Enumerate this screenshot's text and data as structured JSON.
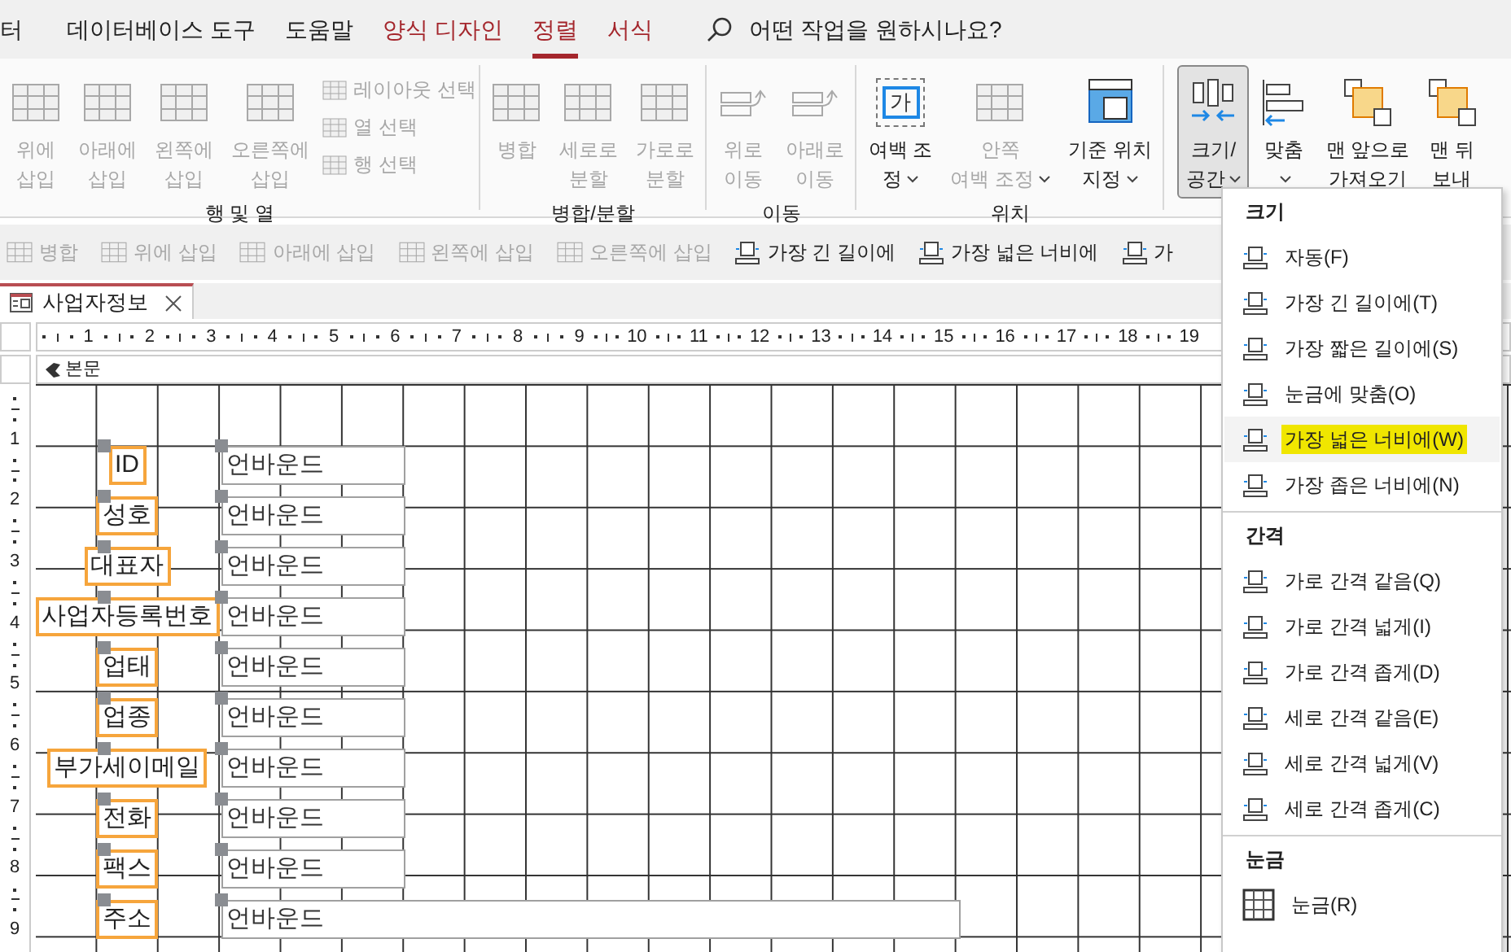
{
  "menu_tabs": [
    {
      "label": "터",
      "selected": false,
      "contextual": false
    },
    {
      "label": "데이터베이스 도구",
      "selected": false,
      "contextual": false
    },
    {
      "label": "도움말",
      "selected": false,
      "contextual": false
    },
    {
      "label": "양식 디자인",
      "selected": false,
      "contextual": true
    },
    {
      "label": "정렬",
      "selected": true,
      "contextual": true
    },
    {
      "label": "서식",
      "selected": false,
      "contextual": true
    }
  ],
  "search": {
    "placeholder": "어떤 작업을 원하시나요?"
  },
  "ribbon_groups": [
    {
      "label": "행 및 열",
      "buttons": [
        {
          "lines": [
            "위에",
            "삽입"
          ],
          "disabled": true,
          "dropdown": false,
          "pressed": false
        },
        {
          "lines": [
            "아래에",
            "삽입"
          ],
          "disabled": true,
          "dropdown": false,
          "pressed": false
        },
        {
          "lines": [
            "왼쪽에",
            "삽입"
          ],
          "disabled": true,
          "dropdown": false,
          "pressed": false
        },
        {
          "lines": [
            "오른쪽에",
            "삽입"
          ],
          "disabled": true,
          "dropdown": false,
          "pressed": false
        }
      ],
      "small_buttons": [
        {
          "label": "레이아웃 선택",
          "disabled": true
        },
        {
          "label": "열 선택",
          "disabled": true
        },
        {
          "label": "행 선택",
          "disabled": true
        }
      ]
    },
    {
      "label": "병합/분할",
      "buttons": [
        {
          "lines": [
            "병합"
          ],
          "disabled": true,
          "dropdown": false,
          "pressed": false
        },
        {
          "lines": [
            "세로로",
            "분할"
          ],
          "disabled": true,
          "dropdown": false,
          "pressed": false
        },
        {
          "lines": [
            "가로로",
            "분할"
          ],
          "disabled": true,
          "dropdown": false,
          "pressed": false
        }
      ]
    },
    {
      "label": "이동",
      "buttons": [
        {
          "lines": [
            "위로",
            "이동"
          ],
          "disabled": true,
          "dropdown": false,
          "pressed": false
        },
        {
          "lines": [
            "아래로",
            "이동"
          ],
          "disabled": true,
          "dropdown": false,
          "pressed": false
        }
      ]
    },
    {
      "label": "위치",
      "buttons": [
        {
          "lines": [
            "여백 조",
            "정"
          ],
          "disabled": false,
          "dropdown": true,
          "pressed": false,
          "icon_text": "가"
        },
        {
          "lines": [
            "안쪽",
            "여백 조정"
          ],
          "disabled": true,
          "dropdown": true,
          "pressed": false
        },
        {
          "lines": [
            "기준 위치",
            "지정"
          ],
          "disabled": false,
          "dropdown": true,
          "pressed": false
        }
      ]
    },
    {
      "buttons": [
        {
          "lines": [
            "크기/",
            "공간"
          ],
          "disabled": false,
          "dropdown": true,
          "pressed": true
        },
        {
          "lines": [
            "맞춤"
          ],
          "disabled": false,
          "dropdown": true,
          "pressed": false
        },
        {
          "lines": [
            "맨 앞으로",
            "가져오기"
          ],
          "disabled": false,
          "dropdown": false,
          "pressed": false
        },
        {
          "lines": [
            "맨 뒤",
            "보내"
          ],
          "disabled": false,
          "dropdown": false,
          "pressed": false
        }
      ]
    }
  ],
  "quick_toolbar": [
    {
      "label": "병합",
      "disabled": true
    },
    {
      "label": "위에 삽입",
      "disabled": true
    },
    {
      "label": "아래에 삽입",
      "disabled": true
    },
    {
      "label": "왼쪽에 삽입",
      "disabled": true
    },
    {
      "label": "오른쪽에 삽입",
      "disabled": true
    },
    {
      "label": "가장 긴 길이에",
      "disabled": false
    },
    {
      "label": "가장 넓은 너비에",
      "disabled": false
    },
    {
      "label": "가",
      "disabled": false
    }
  ],
  "document_tab": {
    "title": "사업자정보"
  },
  "ruler": [
    "1",
    "2",
    "3",
    "4",
    "5",
    "6",
    "7",
    "8",
    "9",
    "10",
    "11",
    "12",
    "13",
    "14",
    "15",
    "16",
    "17",
    "18",
    "19"
  ],
  "vertical_ruler": [
    "1",
    "2",
    "3",
    "4",
    "5",
    "6",
    "7",
    "8",
    "9"
  ],
  "section": {
    "title": "본문"
  },
  "fields": [
    {
      "label": "ID",
      "value": "언바운드",
      "selected": true,
      "wide": false
    },
    {
      "label": "성호",
      "value": "언바운드",
      "selected": true,
      "wide": false
    },
    {
      "label": "대표자",
      "value": "언바운드",
      "selected": true,
      "wide": false
    },
    {
      "label": "사업자등록번호",
      "value": "언바운드",
      "selected": true,
      "wide": false
    },
    {
      "label": "업태",
      "value": "언바운드",
      "selected": true,
      "wide": false
    },
    {
      "label": "업종",
      "value": "언바운드",
      "selected": true,
      "wide": false
    },
    {
      "label": "부가세이메일",
      "value": "언바운드",
      "selected": true,
      "wide": false
    },
    {
      "label": "전화",
      "value": "언바운드",
      "selected": true,
      "wide": false
    },
    {
      "label": "팩스",
      "value": "언바운드",
      "selected": true,
      "wide": false
    },
    {
      "label": "주소",
      "value": "언바운드",
      "selected": true,
      "wide": true
    }
  ],
  "size_menu": [
    {
      "title": "크기",
      "items": [
        {
          "label": "자동(F)",
          "selected": false
        },
        {
          "label": "가장 긴 길이에(T)",
          "selected": false
        },
        {
          "label": "가장 짧은 길이에(S)",
          "selected": false
        },
        {
          "label": "눈금에 맞춤(O)",
          "selected": false
        },
        {
          "label": "가장 넓은 너비에(W)",
          "selected": true
        },
        {
          "label": "가장 좁은 너비에(N)",
          "selected": false
        }
      ]
    },
    {
      "title": "간격",
      "items": [
        {
          "label": "가로 간격 같음(Q)",
          "selected": false
        },
        {
          "label": "가로 간격 넓게(I)",
          "selected": false
        },
        {
          "label": "가로 간격 좁게(D)",
          "selected": false
        },
        {
          "label": "세로 간격 같음(E)",
          "selected": false
        },
        {
          "label": "세로 간격 넓게(V)",
          "selected": false
        },
        {
          "label": "세로 간격 좁게(C)",
          "selected": false
        }
      ]
    },
    {
      "title": "눈금",
      "items": [
        {
          "label": "눈금(R)",
          "selected": false
        }
      ]
    }
  ]
}
